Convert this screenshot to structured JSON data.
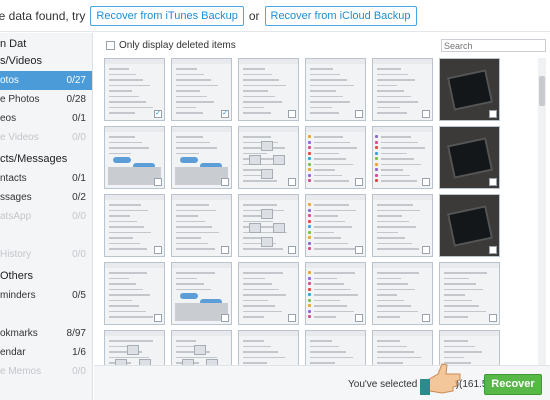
{
  "topbar": {
    "message": "le data found, try",
    "itunes_button": "Recover from iTunes Backup",
    "or": "or",
    "icloud_button": "Recover from iCloud Backup"
  },
  "sidebar": {
    "header": "n Dat",
    "sections": [
      {
        "title": "s/Videos",
        "items": [
          {
            "label": "otos",
            "count": "0/27",
            "state": "selected"
          },
          {
            "label": "e Photos",
            "count": "0/28",
            "state": "normal"
          },
          {
            "label": "eos",
            "count": "0/1",
            "state": "normal"
          },
          {
            "label": "e Videos",
            "count": "0/0",
            "state": "dim"
          }
        ]
      },
      {
        "title": "cts/Messages",
        "items": [
          {
            "label": "ntacts",
            "count": "0/1",
            "state": "normal"
          },
          {
            "label": "ssages",
            "count": "0/2",
            "state": "normal"
          },
          {
            "label": "atsApp",
            "count": "0/0",
            "state": "dim"
          },
          {
            "label": "",
            "count": "",
            "state": "dim"
          },
          {
            "label": "History",
            "count": "0/0",
            "state": "dim"
          }
        ]
      },
      {
        "title": "Others",
        "items": [
          {
            "label": "minders",
            "count": "0/5",
            "state": "normal"
          },
          {
            "label": "",
            "count": "",
            "state": "normal"
          },
          {
            "label": "okmarks",
            "count": "8/97",
            "state": "normal"
          },
          {
            "label": "endar",
            "count": "1/6",
            "state": "normal"
          },
          {
            "label": "e Memos",
            "count": "0/0",
            "state": "dim"
          }
        ]
      }
    ]
  },
  "filter": {
    "only_deleted_label": "Only display deleted items",
    "search_placeholder": "Search"
  },
  "thumbnails": {
    "rows": 5,
    "cols": 6,
    "kinds": [
      "settings",
      "settings",
      "settings",
      "settings",
      "settings",
      "photo",
      "chat",
      "chat",
      "nav",
      "list",
      "list",
      "photo",
      "settings",
      "settings",
      "nav",
      "list",
      "settings",
      "photo",
      "settings",
      "chat",
      "settings",
      "list",
      "settings",
      "settings",
      "nav",
      "nav",
      "settings",
      "settings",
      "settings",
      "settings"
    ],
    "checked": [
      0,
      1
    ]
  },
  "footer": {
    "status": "You've selected 2 item(s)(161.54 KB)",
    "recover_label": "Recover"
  },
  "colors": {
    "accent": "#1a8fd6",
    "recover_green": "#57b848",
    "sidebar_selected": "#4a9bd8"
  }
}
